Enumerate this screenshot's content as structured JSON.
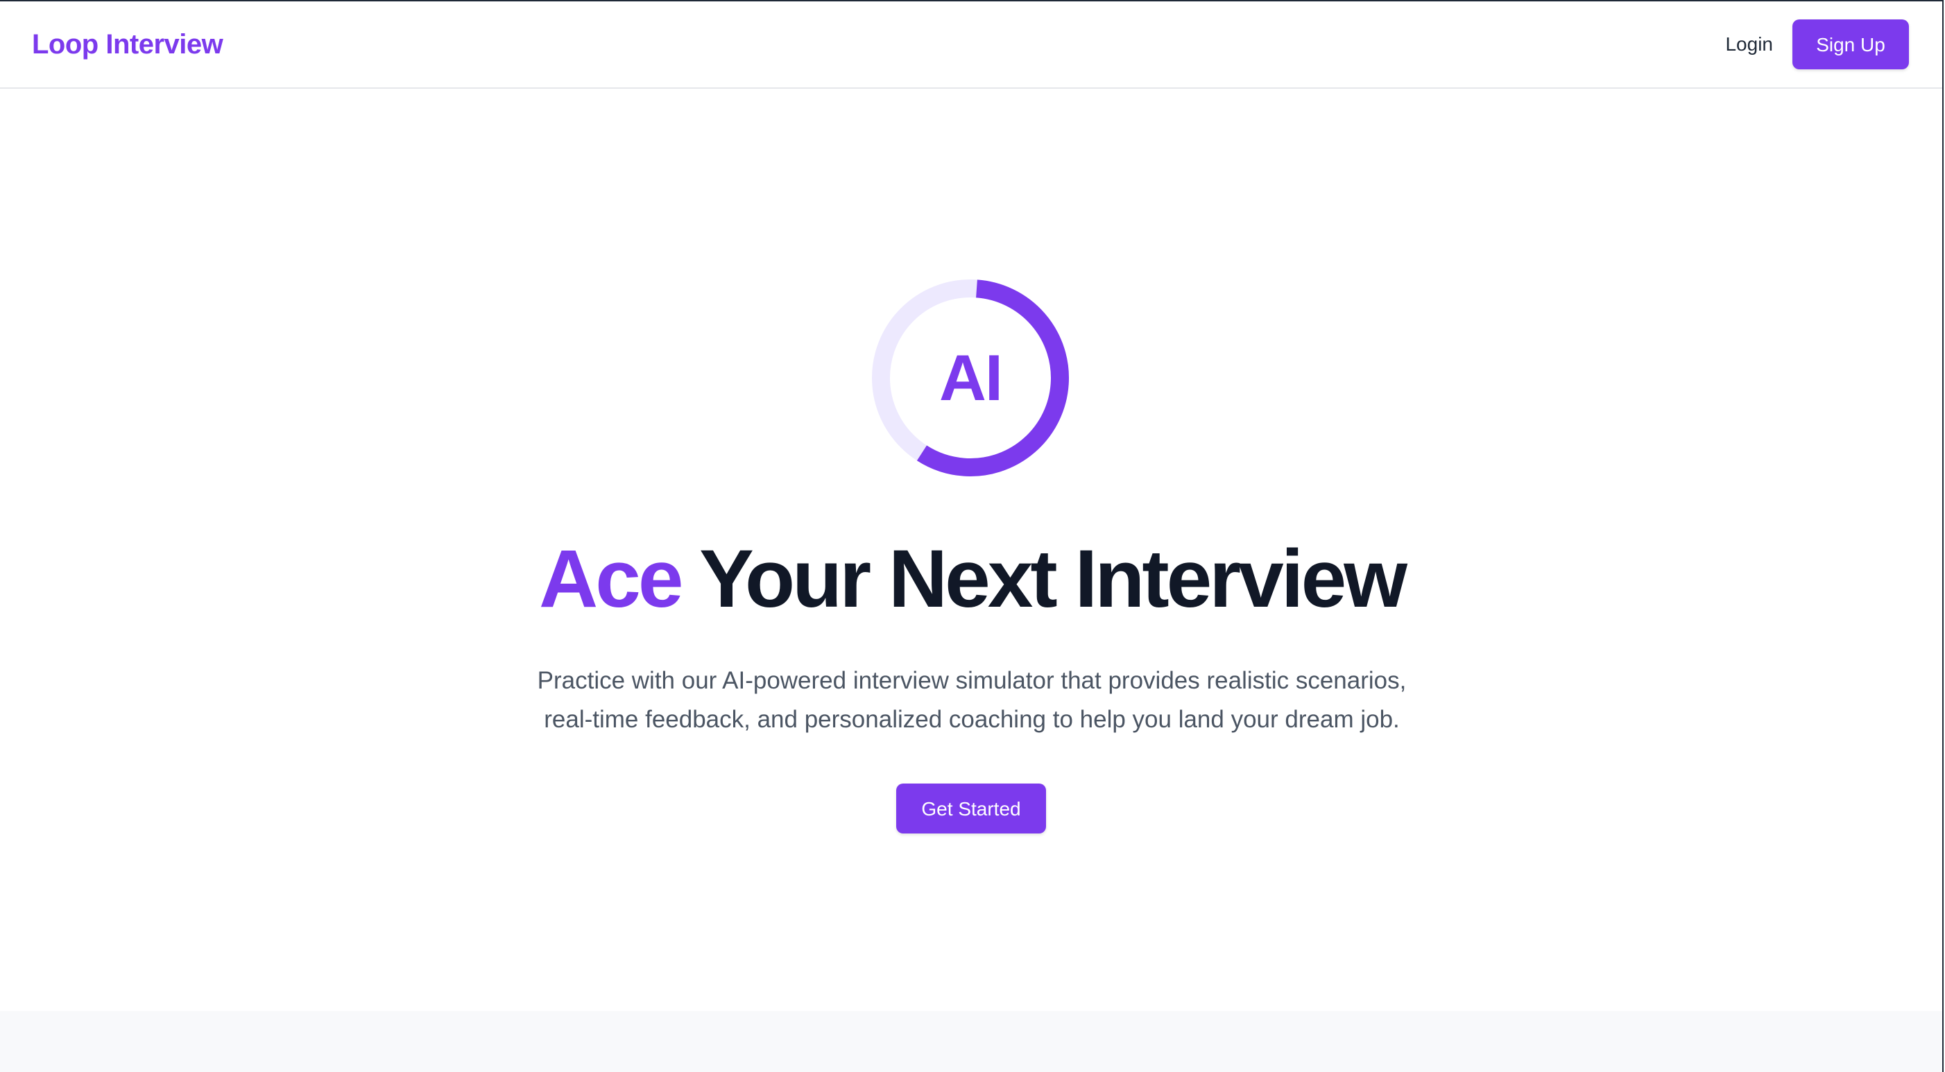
{
  "header": {
    "brand": "Loop Interview",
    "login_label": "Login",
    "signup_label": "Sign Up"
  },
  "hero": {
    "badge_text": "AI",
    "badge_progress": 0.58,
    "headline_accent": "Ace",
    "headline_rest": "Your Next Interview",
    "subtitle_line1": "Practice with our AI-powered interview simulator that provides realistic scenarios,",
    "subtitle_line2": "real-time feedback, and personalized coaching to help you land your dream job.",
    "cta_label": "Get Started"
  },
  "colors": {
    "accent": "#7c3aed",
    "accent_light": "#ede9fe",
    "heading": "#111827",
    "body_text": "#4b5563",
    "footer_band": "#f8f9fb"
  }
}
